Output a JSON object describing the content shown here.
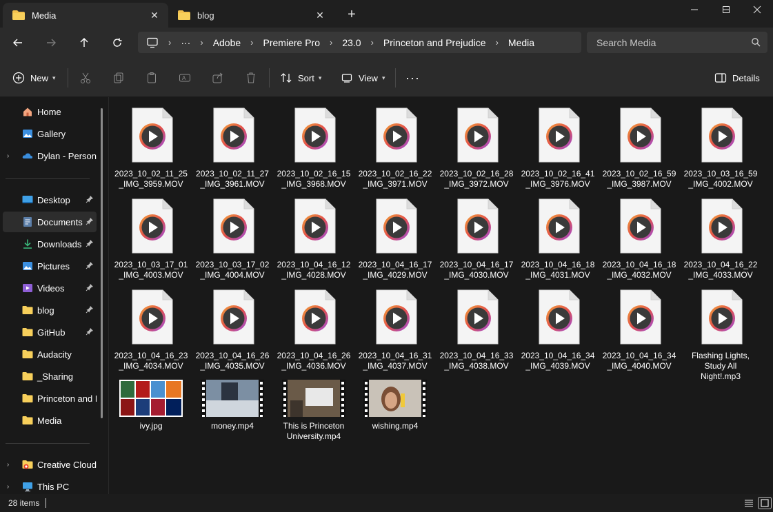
{
  "tabs": [
    {
      "label": "Media",
      "active": true
    },
    {
      "label": "blog",
      "active": false
    }
  ],
  "window_controls": {
    "minimize": "minimize-icon",
    "maximize": "maximize-icon",
    "close": "close-icon"
  },
  "breadcrumb": [
    "Adobe",
    "Premiere Pro",
    "23.0",
    "Princeton and Prejudice",
    "Media"
  ],
  "search": {
    "placeholder": "Search Media"
  },
  "commands": {
    "new_label": "New",
    "sort_label": "Sort",
    "view_label": "View",
    "details_label": "Details"
  },
  "sidebar": {
    "top": [
      {
        "label": "Home",
        "icon": "home-icon"
      },
      {
        "label": "Gallery",
        "icon": "gallery-icon"
      },
      {
        "label": "Dylan - Persona",
        "icon": "onedrive-icon"
      }
    ],
    "quick": [
      {
        "label": "Desktop",
        "icon": "desktop-icon",
        "pinned": true
      },
      {
        "label": "Documents",
        "icon": "documents-icon",
        "pinned": true,
        "selected": true
      },
      {
        "label": "Downloads",
        "icon": "downloads-icon",
        "pinned": true
      },
      {
        "label": "Pictures",
        "icon": "pictures-icon",
        "pinned": true
      },
      {
        "label": "Videos",
        "icon": "videos-icon",
        "pinned": true
      },
      {
        "label": "blog",
        "icon": "folder-icon",
        "pinned": true
      },
      {
        "label": "GitHub",
        "icon": "folder-icon",
        "pinned": true
      },
      {
        "label": "Audacity",
        "icon": "folder-icon",
        "pinned": false
      },
      {
        "label": "_Sharing",
        "icon": "folder-icon",
        "pinned": false
      },
      {
        "label": "Princeton and P",
        "icon": "folder-icon",
        "pinned": false
      },
      {
        "label": "Media",
        "icon": "folder-icon",
        "pinned": false
      }
    ],
    "bottom": [
      {
        "label": "Creative Cloud F",
        "icon": "creative-cloud-icon"
      },
      {
        "label": "This PC",
        "icon": "this-pc-icon"
      }
    ]
  },
  "files": [
    {
      "line1": "2023_10_02_11_25",
      "line2": "_IMG_3959.MOV"
    },
    {
      "line1": "2023_10_02_11_27",
      "line2": "_IMG_3961.MOV"
    },
    {
      "line1": "2023_10_02_16_15",
      "line2": "_IMG_3968.MOV"
    },
    {
      "line1": "2023_10_02_16_22",
      "line2": "_IMG_3971.MOV"
    },
    {
      "line1": "2023_10_02_16_28",
      "line2": "_IMG_3972.MOV"
    },
    {
      "line1": "2023_10_02_16_41",
      "line2": "_IMG_3976.MOV"
    },
    {
      "line1": "2023_10_02_16_59",
      "line2": "_IMG_3987.MOV"
    },
    {
      "line1": "2023_10_03_16_59",
      "line2": "_IMG_4002.MOV"
    },
    {
      "line1": "2023_10_03_17_01",
      "line2": "_IMG_4003.MOV"
    },
    {
      "line1": "2023_10_03_17_02",
      "line2": "_IMG_4004.MOV"
    },
    {
      "line1": "2023_10_04_16_12",
      "line2": "_IMG_4028.MOV"
    },
    {
      "line1": "2023_10_04_16_17",
      "line2": "_IMG_4029.MOV"
    },
    {
      "line1": "2023_10_04_16_17",
      "line2": "_IMG_4030.MOV"
    },
    {
      "line1": "2023_10_04_16_18",
      "line2": "_IMG_4031.MOV"
    },
    {
      "line1": "2023_10_04_16_18",
      "line2": "_IMG_4032.MOV"
    },
    {
      "line1": "2023_10_04_16_22",
      "line2": "_IMG_4033.MOV"
    },
    {
      "line1": "2023_10_04_16_23",
      "line2": "_IMG_4034.MOV"
    },
    {
      "line1": "2023_10_04_16_26",
      "line2": "_IMG_4035.MOV"
    },
    {
      "line1": "2023_10_04_16_26",
      "line2": "_IMG_4036.MOV"
    },
    {
      "line1": "2023_10_04_16_31",
      "line2": "_IMG_4037.MOV"
    },
    {
      "line1": "2023_10_04_16_33",
      "line2": "_IMG_4038.MOV"
    },
    {
      "line1": "2023_10_04_16_34",
      "line2": "_IMG_4039.MOV"
    },
    {
      "line1": "2023_10_04_16_34",
      "line2": "_IMG_4040.MOV"
    },
    {
      "line1": "Flashing Lights,",
      "line2": "Study All",
      "line3": "Night!.mp3"
    }
  ],
  "media": [
    {
      "name": "ivy.jpg",
      "kind": "image"
    },
    {
      "name": "money.mp4",
      "kind": "video"
    },
    {
      "name": "This is Princeton University.mp4",
      "kind": "video"
    },
    {
      "name": "wishing.mp4",
      "kind": "video"
    }
  ],
  "status": {
    "item_count": "28 items"
  }
}
